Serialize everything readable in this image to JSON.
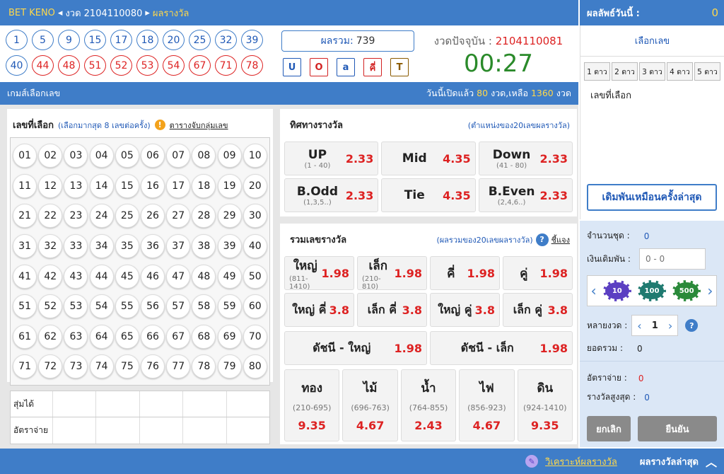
{
  "topbar": {
    "brand": "BET KENO",
    "draw_label": "งวด 2104110080",
    "results_link": "ผลรางวัล"
  },
  "today_results": {
    "label": "ผลลัพธ์วันนี้ :",
    "value": "0"
  },
  "result_balls": {
    "row1": [
      "1",
      "5",
      "9",
      "15",
      "17",
      "18",
      "20",
      "25",
      "32",
      "39"
    ],
    "row2": [
      "40",
      "44",
      "48",
      "51",
      "52",
      "53",
      "54",
      "67",
      "71",
      "78"
    ]
  },
  "sum_box": {
    "label": "ผลรวม:",
    "value": "739"
  },
  "result_tags": [
    {
      "label": "U",
      "color": "#2059b6"
    },
    {
      "label": "O",
      "color": "#d22222"
    },
    {
      "label": "a",
      "color": "#2059b6"
    },
    {
      "label": "คี่",
      "color": "#d22222"
    },
    {
      "label": "T",
      "color": "#8a5a00"
    }
  ],
  "current_draw": {
    "label": "งวดปัจจุบัน :",
    "number": "2104110081",
    "timer": "00:27"
  },
  "select_panel": {
    "title": "เลือกเลข",
    "star_tabs": [
      "1 ดาว",
      "2 ดาว",
      "3 ดาว",
      "4 ดาว",
      "5 ดาว"
    ],
    "picked_label": "เลขที่เลือก",
    "repeat_button": "เดิมพันเหมือนครั้งล่าสุด"
  },
  "game_bar": {
    "title": "เกมส์เลือกเลข",
    "status_prefix": "วันนี้เปิดแล้ว",
    "opened": "80",
    "mid": "งวด,เหลือ",
    "remaining": "1360",
    "suffix": "งวด"
  },
  "number_panel": {
    "title": "เลขที่เลือก",
    "hint": "(เลือกมากสุด 8 เลขต่อครั้ง)",
    "link": "ตารางจับกลุ่มเลข",
    "numbers": [
      "01",
      "02",
      "03",
      "04",
      "05",
      "06",
      "07",
      "08",
      "09",
      "10",
      "11",
      "12",
      "13",
      "14",
      "15",
      "16",
      "17",
      "18",
      "19",
      "20",
      "21",
      "22",
      "23",
      "24",
      "25",
      "26",
      "27",
      "28",
      "29",
      "30",
      "31",
      "32",
      "33",
      "34",
      "35",
      "36",
      "37",
      "38",
      "39",
      "40",
      "41",
      "42",
      "43",
      "44",
      "45",
      "46",
      "47",
      "48",
      "49",
      "50",
      "51",
      "52",
      "53",
      "54",
      "55",
      "56",
      "57",
      "58",
      "59",
      "60",
      "61",
      "62",
      "63",
      "64",
      "65",
      "66",
      "67",
      "68",
      "69",
      "70",
      "71",
      "72",
      "73",
      "74",
      "75",
      "76",
      "77",
      "78",
      "79",
      "80"
    ],
    "stats_rows": [
      "สุ่มได้",
      "อัตราจ่าย"
    ]
  },
  "direction_panel": {
    "title": "ทิศทางรางวัล",
    "hint": "(ตำแหน่งของ20เลขผลรางวัล)",
    "cells": [
      {
        "name": "UP",
        "sub": "(1 - 40)",
        "odd": "2.33"
      },
      {
        "name": "Mid",
        "sub": "",
        "odd": "4.35"
      },
      {
        "name": "Down",
        "sub": "(41 - 80)",
        "odd": "2.33"
      },
      {
        "name": "B.Odd",
        "sub": "(1,3,5..)",
        "odd": "2.33"
      },
      {
        "name": "Tie",
        "sub": "",
        "odd": "4.35"
      },
      {
        "name": "B.Even",
        "sub": "(2,4,6..)",
        "odd": "2.33"
      }
    ]
  },
  "sum_panel": {
    "title": "รวมเลขรางวัล",
    "hint": "(ผลรวมของ20เลขผลรางวัล)",
    "explain": "ชี้แจง",
    "row1": [
      {
        "name": "ใหญ่",
        "sub": "(811-1410)",
        "odd": "1.98"
      },
      {
        "name": "เล็ก",
        "sub": "(210-810)",
        "odd": "1.98"
      },
      {
        "name": "คี่",
        "sub": "",
        "odd": "1.98"
      },
      {
        "name": "คู่",
        "sub": "",
        "odd": "1.98"
      }
    ],
    "row2": [
      {
        "name": "ใหญ่ คี่",
        "odd": "3.8"
      },
      {
        "name": "เล็ก คี่",
        "odd": "3.8"
      },
      {
        "name": "ใหญ่ คู่",
        "odd": "3.8"
      },
      {
        "name": "เล็ก คู่",
        "odd": "3.8"
      }
    ],
    "row3": [
      {
        "name": "ดัชนี - ใหญ่",
        "odd": "1.98"
      },
      {
        "name": "ดัชนี - เล็ก",
        "odd": "1.98"
      }
    ],
    "elements": [
      {
        "name": "ทอง",
        "range": "(210-695)",
        "odd": "9.35"
      },
      {
        "name": "ไม้",
        "range": "(696-763)",
        "odd": "4.67"
      },
      {
        "name": "น้ำ",
        "range": "(764-855)",
        "odd": "2.43"
      },
      {
        "name": "ไฟ",
        "range": "(856-923)",
        "odd": "4.67"
      },
      {
        "name": "ดิน",
        "range": "(924-1410)",
        "odd": "9.35"
      }
    ]
  },
  "bet_panel": {
    "sets_label": "จำนวนชุด :",
    "sets_value": "0",
    "amount_label": "เงินเดิมพัน :",
    "amount_placeholder": "0 - 0",
    "chips": [
      "10",
      "100",
      "500"
    ],
    "multi_label": "หลายงวด :",
    "multi_value": "1",
    "total_label": "ยอดรวม :",
    "total_value": "0",
    "payout_label": "อัตราจ่าย :",
    "payout_value": "0",
    "max_label": "รางวัลสูงสุด :",
    "max_value": "0",
    "cancel": "ยกเลิก",
    "confirm": "ยืนยัน"
  },
  "bottombar": {
    "analysis": "วิเคราะห์ผลรางวัล",
    "latest": "ผลรางวัลล่าสุด"
  }
}
